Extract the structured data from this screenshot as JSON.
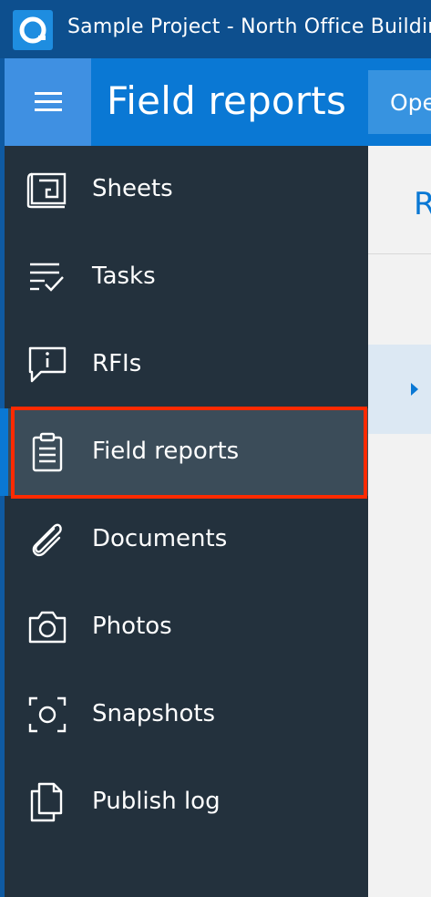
{
  "window": {
    "title": "Sample Project - North Office Building",
    "logo_icon": "app-logo-icon"
  },
  "header": {
    "menu_icon": "hamburger-icon",
    "title": "Field reports",
    "button_label": "Open"
  },
  "sidebar": {
    "items": [
      {
        "label": "Sheets",
        "icon": "sheets-icon"
      },
      {
        "label": "Tasks",
        "icon": "tasks-icon"
      },
      {
        "label": "RFIs",
        "icon": "rfis-icon"
      },
      {
        "label": "Field reports",
        "icon": "field-reports-icon",
        "selected": true
      },
      {
        "label": "Documents",
        "icon": "paperclip-icon"
      },
      {
        "label": "Photos",
        "icon": "camera-icon"
      },
      {
        "label": "Snapshots",
        "icon": "snapshot-icon"
      },
      {
        "label": "Publish log",
        "icon": "publish-log-icon"
      }
    ]
  },
  "content": {
    "heading": "Reports"
  },
  "colors": {
    "titlebar": "#0d4f8e",
    "header": "#0a78d4",
    "sidebar": "#23313d",
    "selected": "#3b4c59",
    "highlight": "#ff2a00"
  }
}
